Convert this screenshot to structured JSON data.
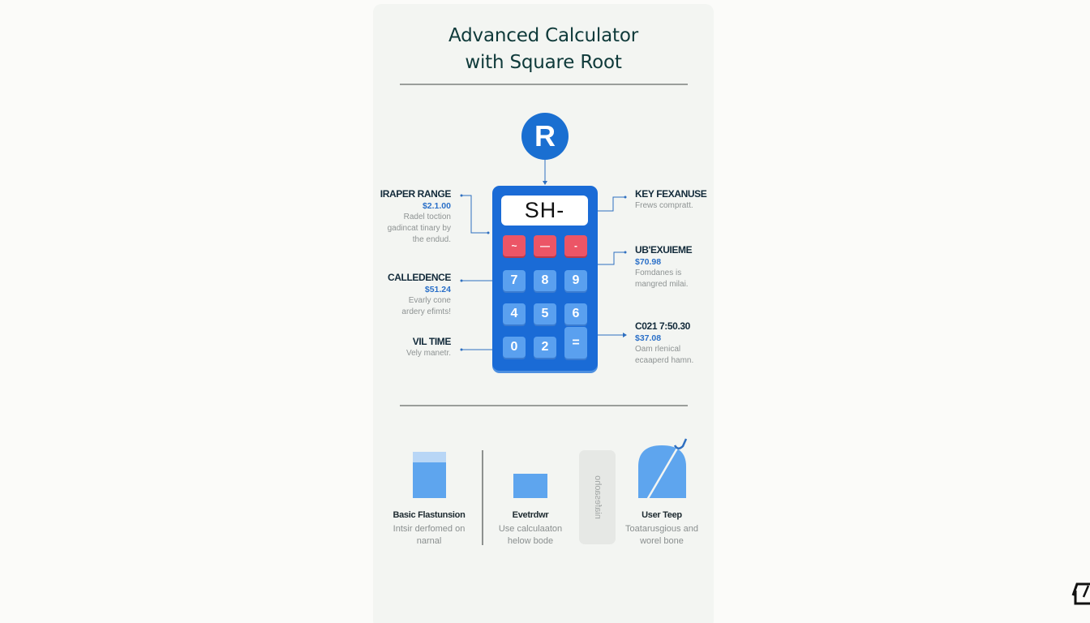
{
  "title": {
    "line1": "Advanced Calculator",
    "line2": "with Square Root"
  },
  "badge": {
    "letter": "R",
    "icon": "r-logo-icon"
  },
  "calculator": {
    "display": "SH-",
    "function_keys": [
      "~",
      "—",
      "-"
    ],
    "keys": {
      "row1": [
        "7",
        "8",
        "9"
      ],
      "row2": [
        "4",
        "5",
        "6"
      ],
      "row3": [
        "0",
        "2",
        "="
      ]
    },
    "colors": {
      "body": "#1a6bd6",
      "key": "#5aa0ef",
      "function_key": "#ec5566",
      "display": "#ffffff"
    }
  },
  "annotations_left": [
    {
      "heading": "IRAPER RANGE",
      "price": "$2.1.00",
      "desc_lines": [
        "Radel toction",
        "gadincat tinary by",
        "the endud."
      ]
    },
    {
      "heading": "CALLEDENCE",
      "price": "$51.24",
      "desc_lines": [
        "Evarly cone",
        "ardery efimts!"
      ]
    },
    {
      "heading": "VIL TIME",
      "price": "",
      "desc_lines": [
        "Vely manetr."
      ]
    }
  ],
  "annotations_right": [
    {
      "heading": "KEY FEXANUSE",
      "price": "",
      "desc_lines": [
        "Frews compratt."
      ]
    },
    {
      "heading": "UB'EXUIEME",
      "price": "$70.98",
      "desc_lines": [
        "Fomdanes is",
        "mangred milai."
      ]
    },
    {
      "heading": "C021 7:50.30",
      "price": "$37.08",
      "desc_lines": [
        "Oam rlenical",
        "ecaaperd hamn."
      ]
    }
  ],
  "features": [
    {
      "heading": "Basic Flastunsion",
      "desc_lines": [
        "Intsir derfomed on",
        "narnal"
      ],
      "icon": "bar-block-icon"
    },
    {
      "heading": "Evetrdwr",
      "desc_lines": [
        "Use calculaaton",
        "helow bode"
      ],
      "icon": "rectangle-icon"
    },
    {
      "vertical_text": "niafesaoho",
      "icon": "vertical-tab"
    },
    {
      "heading": "User Teep",
      "desc_lines": [
        "Toatarusgious and",
        "worel bone"
      ],
      "icon": "arch-slash-icon"
    }
  ],
  "accent_color": "#1a6fd1",
  "heading_color": "#0f3a3a"
}
